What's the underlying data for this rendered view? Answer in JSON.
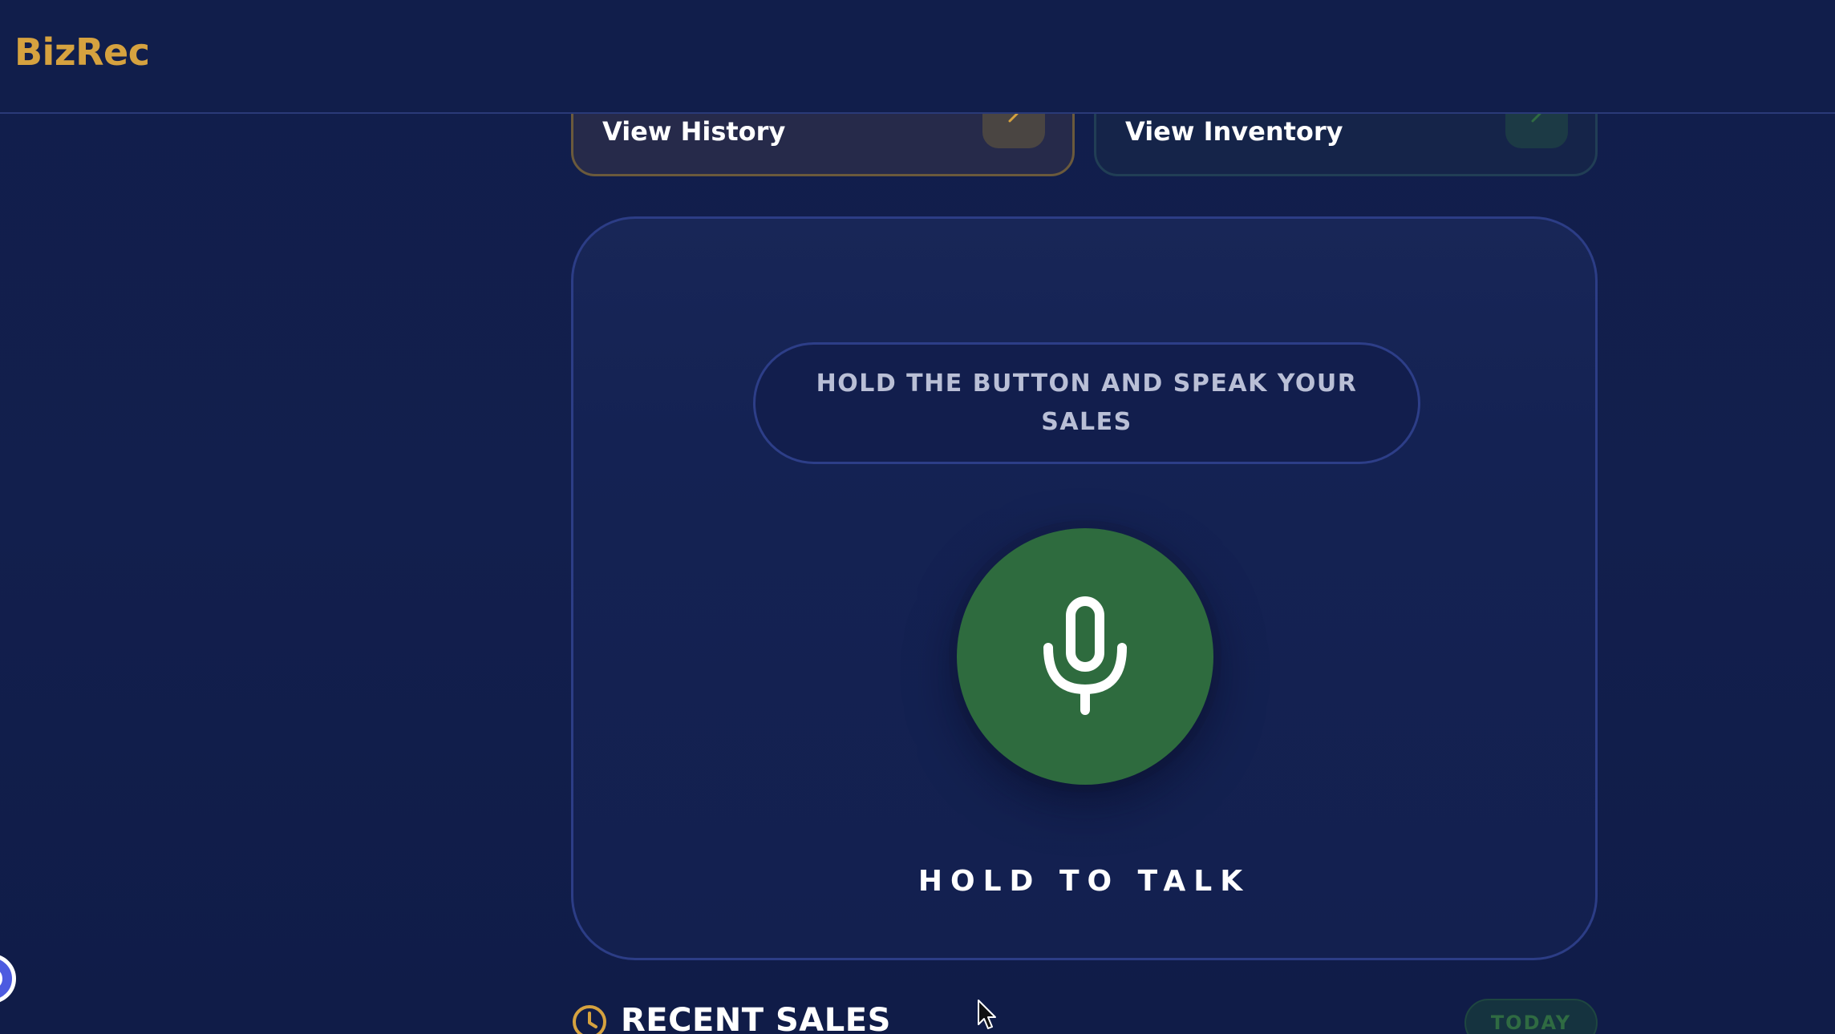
{
  "app": {
    "brand": "BizRec"
  },
  "quick_actions": {
    "history": {
      "label": "View History",
      "icon": "chevron-right-icon",
      "accent": "#d6a23f"
    },
    "inventory": {
      "label": "View Inventory",
      "icon": "chevron-right-icon",
      "accent": "#2f6b42"
    }
  },
  "recorder": {
    "instruction": "HOLD THE BUTTON AND SPEAK YOUR SALES",
    "mic_icon": "microphone-icon",
    "mic_color": "#2e6b3e",
    "action_label": "HOLD TO TALK"
  },
  "recent_sales": {
    "icon": "clock-icon",
    "title": "RECENT SALES",
    "badge": "TODAY"
  },
  "colors": {
    "background": "#111d4a",
    "brand": "#d6a23f",
    "success": "#2e6b3e"
  }
}
